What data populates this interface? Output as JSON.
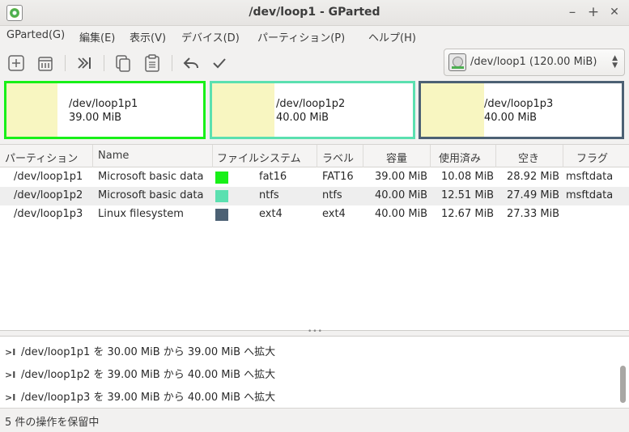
{
  "window": {
    "title": "/dev/loop1 - GParted",
    "minimize_glyph": "–",
    "maximize_glyph": "+",
    "close_glyph": "✕"
  },
  "menu": [
    "GParted(G)",
    "編集(E)",
    "表示(V)",
    "デバイス(D)",
    "パーティション(P)",
    "ヘルプ(H)"
  ],
  "toolbar": {
    "icons": [
      "new-partition-icon",
      "delete-icon",
      "resize-move-icon",
      "copy-icon",
      "paste-icon",
      "undo-icon",
      "apply-icon"
    ]
  },
  "device_selector": {
    "label": "/dev/loop1  (120.00 MiB)"
  },
  "partition_map": [
    {
      "name": "/dev/loop1p1",
      "size": "39.00 MiB",
      "border_color": "#18f018",
      "used_fraction": 0.259
    },
    {
      "name": "/dev/loop1p2",
      "size": "40.00 MiB",
      "border_color": "#5be0b0",
      "used_fraction": 0.313
    },
    {
      "name": "/dev/loop1p3",
      "size": "40.00 MiB",
      "border_color": "#4c6174",
      "used_fraction": 0.317
    }
  ],
  "table": {
    "headers": [
      "パーティション",
      "Name",
      "ファイルシステム",
      "ラベル",
      "容量",
      "使用済み",
      "空き",
      "フラグ"
    ],
    "rows": [
      {
        "partition": "/dev/loop1p1",
        "name": "Microsoft basic data",
        "fs_color": "#18f018",
        "filesystem": "fat16",
        "label": "FAT16",
        "size": "39.00 MiB",
        "used": "10.08 MiB",
        "free": "28.92 MiB",
        "flags": "msftdata"
      },
      {
        "partition": "/dev/loop1p2",
        "name": "Microsoft basic data",
        "fs_color": "#5be0b0",
        "filesystem": "ntfs",
        "label": "ntfs",
        "size": "40.00 MiB",
        "used": "12.51 MiB",
        "free": "27.49 MiB",
        "flags": "msftdata"
      },
      {
        "partition": "/dev/loop1p3",
        "name": "Linux filesystem",
        "fs_color": "#4c6174",
        "filesystem": "ext4",
        "label": "ext4",
        "size": "40.00 MiB",
        "used": "12.67 MiB",
        "free": "27.33 MiB",
        "flags": ""
      }
    ]
  },
  "operations": [
    {
      "glyph": ">I",
      "text": "/dev/loop1p1 を 30.00 MiB から 39.00 MiB へ拡大"
    },
    {
      "glyph": ">I",
      "text": "/dev/loop1p2 を 39.00 MiB から 40.00 MiB へ拡大"
    },
    {
      "glyph": ">I",
      "text": "/dev/loop1p3 を 39.00 MiB から 40.00 MiB へ拡大"
    }
  ],
  "status": "5 件の操作を保留中"
}
